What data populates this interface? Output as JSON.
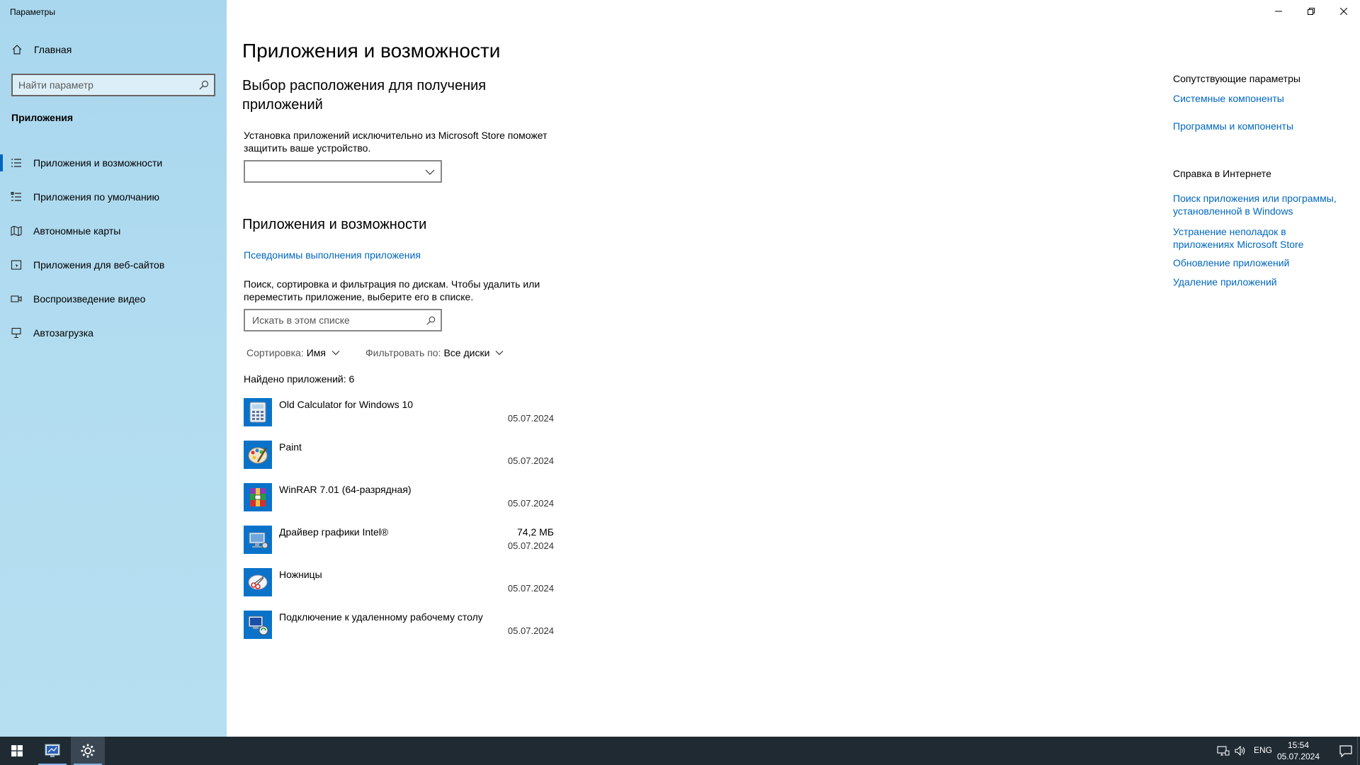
{
  "window": {
    "title": "Параметры"
  },
  "sidebar": {
    "home": "Главная",
    "search_placeholder": "Найти параметр",
    "section": "Приложения",
    "items": [
      {
        "label": "Приложения и возможности",
        "icon": "list-icon"
      },
      {
        "label": "Приложения по умолчанию",
        "icon": "default-apps-icon"
      },
      {
        "label": "Автономные карты",
        "icon": "map-icon"
      },
      {
        "label": "Приложения для веб-сайтов",
        "icon": "web-apps-icon"
      },
      {
        "label": "Воспроизведение видео",
        "icon": "video-icon"
      },
      {
        "label": "Автозагрузка",
        "icon": "startup-icon"
      }
    ]
  },
  "main": {
    "page_title": "Приложения и возможности",
    "location": {
      "title": "Выбор расположения для получения приложений",
      "description": "Установка приложений исключительно из Microsoft Store поможет защитить ваше устройство.",
      "dropdown_value": ""
    },
    "apps": {
      "title": "Приложения и возможности",
      "alias_link": "Псевдонимы выполнения приложения",
      "description": "Поиск, сортировка и фильтрация по дискам. Чтобы удалить или переместить приложение, выберите его в списке.",
      "search_placeholder": "Искать в этом списке",
      "sort_label": "Сортировка:",
      "sort_value": "Имя",
      "filter_label": "Фильтровать по:",
      "filter_value": "Все диски",
      "found": "Найдено приложений: 6",
      "list": [
        {
          "name": "Old Calculator for Windows 10",
          "size": "",
          "date": "05.07.2024",
          "icon": "calculator-icon"
        },
        {
          "name": "Paint",
          "size": "",
          "date": "05.07.2024",
          "icon": "paint-icon"
        },
        {
          "name": "WinRAR 7.01 (64-разрядная)",
          "size": "",
          "date": "05.07.2024",
          "icon": "winrar-icon"
        },
        {
          "name": "Драйвер графики Intel®",
          "size": "74,2 МБ",
          "date": "05.07.2024",
          "icon": "intel-graphics-icon"
        },
        {
          "name": "Ножницы",
          "size": "",
          "date": "05.07.2024",
          "icon": "snipping-tool-icon"
        },
        {
          "name": "Подключение к удаленному рабочему столу",
          "size": "",
          "date": "05.07.2024",
          "icon": "remote-desktop-icon"
        }
      ]
    }
  },
  "related": {
    "heading": "Сопутствующие параметры",
    "links": [
      "Системные компоненты",
      "Программы и компоненты"
    ],
    "help_heading": "Справка в Интернете",
    "help_links": [
      "Поиск приложения или программы, установленной в Windows",
      "Устранение неполадок в приложениях Microsoft Store",
      "Обновление приложений",
      "Удаление приложений"
    ]
  },
  "taskbar": {
    "language": "ENG",
    "time": "15:54",
    "date": "05.07.2024"
  },
  "colors": {
    "accent": "#0067c0",
    "taskbar": "#1f2a33",
    "sidebar": "#b2dcf0"
  }
}
